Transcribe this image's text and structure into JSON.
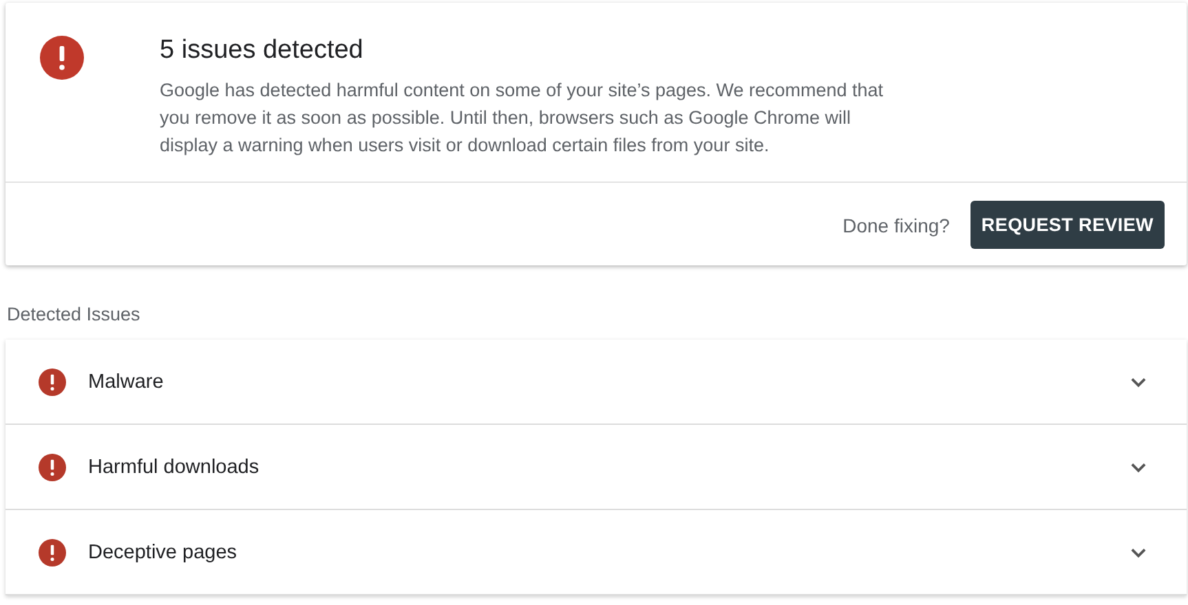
{
  "alert": {
    "title": "5 issues detected",
    "message": "Google has detected harmful content on some of your site’s pages. We recommend that you remove it as soon as possible. Until then, browsers such as Google Chrome will display a warning when users visit or download certain files from your site.",
    "prompt": "Done fixing?",
    "button": "REQUEST REVIEW"
  },
  "section_label": "Detected Issues",
  "issues": [
    {
      "label": "Malware",
      "expanded": false
    },
    {
      "label": "Harmful downloads",
      "expanded": false
    },
    {
      "label": "Deceptive pages",
      "expanded": false
    }
  ]
}
